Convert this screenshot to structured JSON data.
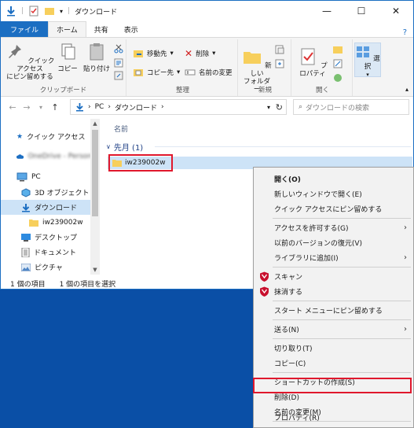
{
  "window": {
    "title": "ダウンロード",
    "controls": {
      "minimize": "—",
      "maximize": "☐",
      "close": "✕"
    }
  },
  "ribbon": {
    "tabs": [
      "ファイル",
      "ホーム",
      "共有",
      "表示"
    ],
    "groups": {
      "clipboard": {
        "label": "クリップボード",
        "pin": "クイック アクセス\nにピン留めする",
        "copy": "コピー",
        "paste": "貼り付け"
      },
      "organize": {
        "label": "整理",
        "move_to": "移動先",
        "copy_to": "コピー先",
        "delete": "削除",
        "rename": "名前の変更"
      },
      "new": {
        "label": "新規",
        "new_folder": "新しい\nフォルダー"
      },
      "open": {
        "label": "開く",
        "properties": "プロパティ"
      },
      "select": {
        "label": "選択",
        "select": "選択"
      }
    }
  },
  "address": {
    "path": [
      "PC",
      "ダウンロード"
    ],
    "search_placeholder": "ダウンロードの検索"
  },
  "navpane": {
    "items": [
      {
        "label": "クイック アクセス"
      },
      {
        "label": "OneDrive - Person"
      },
      {
        "label": "PC"
      },
      {
        "label": "3D オブジェクト"
      },
      {
        "label": "ダウンロード"
      },
      {
        "label": "iw239002w"
      },
      {
        "label": "デスクトップ"
      },
      {
        "label": "ドキュメント"
      },
      {
        "label": "ピクチャ"
      }
    ]
  },
  "content": {
    "column_header": "名前",
    "group_label": "先月 (1)",
    "files": [
      {
        "name": "iw239002w"
      }
    ]
  },
  "status": {
    "count": "1 個の項目",
    "selected": "1 個の項目を選択"
  },
  "context_menu": {
    "items": [
      {
        "label": "開く(O)",
        "bold": true
      },
      {
        "label": "新しいウィンドウで開く(E)"
      },
      {
        "label": "クイック アクセスにピン留めする"
      },
      {
        "label": "アクセスを許可する(G)",
        "submenu": true
      },
      {
        "label": "以前のバージョンの復元(V)"
      },
      {
        "label": "ライブラリに追加(I)",
        "submenu": true
      },
      {
        "label": "スキャン"
      },
      {
        "label": "抹消する"
      },
      {
        "label": "スタート メニューにピン留めする"
      },
      {
        "label": "送る(N)",
        "submenu": true
      },
      {
        "label": "切り取り(T)"
      },
      {
        "label": "コピー(C)"
      },
      {
        "label": "ショートカットの作成(S)"
      },
      {
        "label": "削除(D)"
      },
      {
        "label": "名前の変更(M)"
      },
      {
        "label": "プロパティ(R)"
      }
    ]
  },
  "colors": {
    "accent": "#1b6ec2",
    "desktop": "#0a4fa6",
    "selection": "#cde3f7",
    "highlight_box": "#e0182d",
    "folder": "#f7cf5c"
  }
}
